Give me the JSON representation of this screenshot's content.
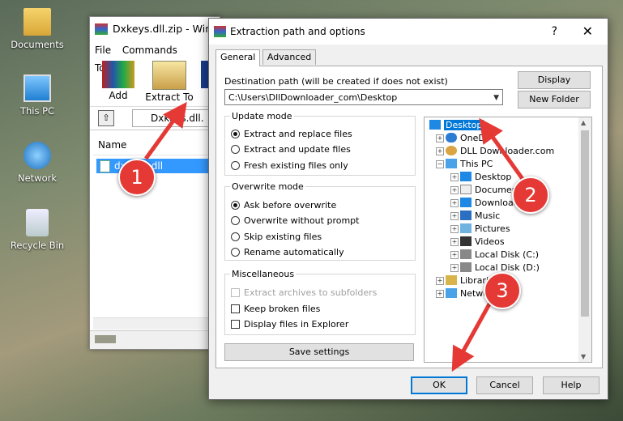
{
  "desktop": {
    "icons": [
      {
        "label": "Documents"
      },
      {
        "label": "This PC"
      },
      {
        "label": "Network"
      },
      {
        "label": "Recycle Bin"
      }
    ]
  },
  "winrar": {
    "title": "Dxkeys.dll.zip - Win",
    "menu": [
      "File",
      "Commands",
      "Tools"
    ],
    "toolbar": {
      "add": "Add",
      "extract_to": "Extract To"
    },
    "path": "Dxkeys.dll.",
    "column_name": "Name",
    "file_name": "dxkeys.dll"
  },
  "dialog": {
    "title": "Extraction path and options",
    "help_glyph": "?",
    "close_glyph": "✕",
    "tabs": [
      "General",
      "Advanced"
    ],
    "destination_label": "Destination path (will be created if does not exist)",
    "destination_value": "C:\\Users\\DllDownloader_com\\Desktop",
    "display_button": "Display",
    "new_folder_button": "New Folder",
    "update_mode": {
      "legend": "Update mode",
      "options": [
        "Extract and replace files",
        "Extract and update files",
        "Fresh existing files only"
      ],
      "selected": 0
    },
    "overwrite_mode": {
      "legend": "Overwrite mode",
      "options": [
        "Ask before overwrite",
        "Overwrite without prompt",
        "Skip existing files",
        "Rename automatically"
      ],
      "selected": 0
    },
    "misc": {
      "legend": "Miscellaneous",
      "options": [
        "Extract archives to subfolders",
        "Keep broken files",
        "Display files in Explorer"
      ]
    },
    "save_settings": "Save settings",
    "tree": [
      "Desktop",
      "OneDr",
      "DLL Downloader.com",
      "This PC",
      "Desktop",
      "Documen",
      "Downloads",
      "Music",
      "Pictures",
      "Videos",
      "Local Disk (C:)",
      "Local Disk (D:)",
      "Librarie",
      "Netwo"
    ],
    "ok": "OK",
    "cancel": "Cancel",
    "help": "Help"
  },
  "markers": [
    "1",
    "2",
    "3"
  ],
  "colors": {
    "marker": "#e53935",
    "selection": "#0078d7",
    "arrow": "#e53935"
  }
}
